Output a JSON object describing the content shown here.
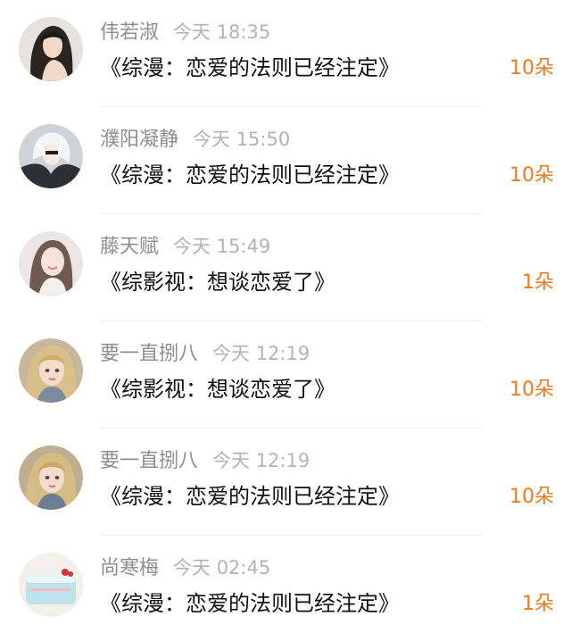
{
  "items": [
    {
      "user": "伟若淑",
      "time": "今天 18:35",
      "title": "《综漫：恋爱的法则已经注定》",
      "count": "10朵",
      "avatar": "woman-dark-hair-avatar"
    },
    {
      "user": "濮阳凝静",
      "time": "今天 15:50",
      "title": "《综漫：恋爱的法则已经注定》",
      "count": "10朵",
      "avatar": "anime-white-hair-avatar"
    },
    {
      "user": "藤天赋",
      "time": "今天 15:49",
      "title": "《综影视：想谈恋爱了》",
      "count": "1朵",
      "avatar": "woman-portrait-avatar"
    },
    {
      "user": "要一直捌八",
      "time": "今天 12:19",
      "title": "《综影视：想谈恋爱了》",
      "count": "10朵",
      "avatar": "illustrated-girl-avatar"
    },
    {
      "user": "要一直捌八",
      "time": "今天 12:19",
      "title": "《综漫：恋爱的法则已经注定》",
      "count": "10朵",
      "avatar": "illustrated-girl-avatar"
    },
    {
      "user": "尚寒梅",
      "time": "今天 02:45",
      "title": "《综漫：恋爱的法则已经注定》",
      "count": "1朵",
      "avatar": "cake-avatar"
    }
  ],
  "colors": {
    "accent": "#f07a1e",
    "username": "#8e8e8e",
    "time": "#b3b3b3",
    "title": "#111111"
  }
}
